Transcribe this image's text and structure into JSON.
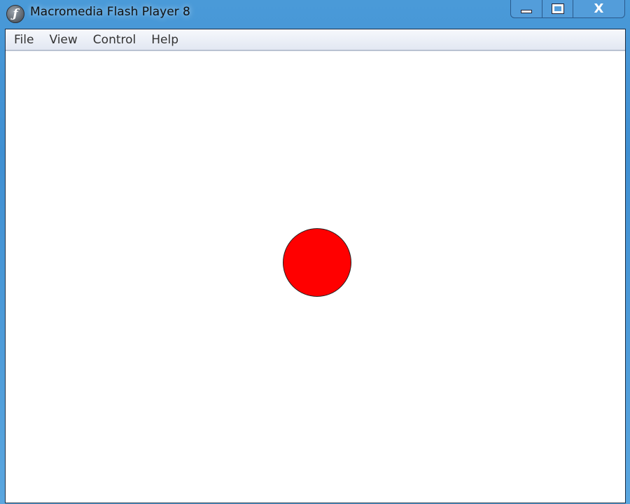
{
  "window": {
    "title": "Macromedia Flash Player 8",
    "app_icon": "flash-icon"
  },
  "controls": {
    "minimize": "minimize-icon",
    "maximize": "maximize-icon",
    "close": "X"
  },
  "menu": [
    "File",
    "View",
    "Control",
    "Help"
  ],
  "stage": {
    "shape": "circle",
    "fill": "#ff0000",
    "stroke": "#222222"
  }
}
